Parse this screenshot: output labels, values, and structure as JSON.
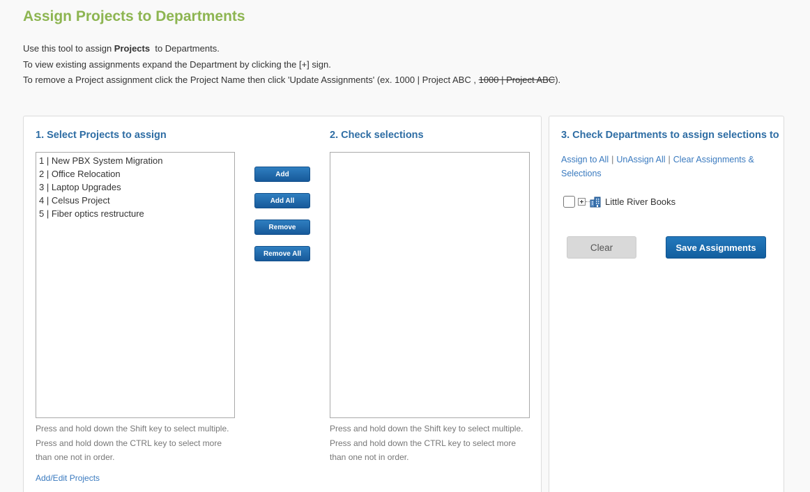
{
  "page": {
    "title": "Assign Projects to Departments",
    "intro": {
      "line1_prefix": "Use this tool to assign ",
      "line1_bold": "Projects",
      "line1_suffix": "  to Departments.",
      "line2": "To view existing assignments expand the Department by clicking the [+] sign.",
      "line3_prefix": "To remove a Project assignment click the Project Name then click 'Update Assignments' (ex. 1000 | Project ABC ,",
      "line3_strike": "1000 | Project ABC",
      "line3_suffix": ")."
    }
  },
  "step1": {
    "title": "1. Select Projects to assign",
    "options": [
      "1 | New PBX System Migration",
      "2 | Office Relocation",
      "3 | Laptop Upgrades",
      "4 | Celsus Project",
      "5 | Fiber optics restructure"
    ],
    "hint_lines": [
      "Press and hold down the Shift key to select multiple.",
      "Press and hold down the CTRL key to select more",
      "than one not in order."
    ],
    "add_edit_link": "Add/Edit Projects"
  },
  "middle_buttons": {
    "add": "Add",
    "add_all": "Add All",
    "remove": "Remove",
    "remove_all": "Remove All"
  },
  "step2": {
    "title": "2. Check selections",
    "hint_lines": [
      "Press and hold down the Shift key to select multiple.",
      "Press and hold down the CTRL key to select more",
      "than one not in order."
    ]
  },
  "step3": {
    "title": "3. Check Departments to assign selections to",
    "links": {
      "assign_all": "Assign to All",
      "unassign_all": "UnAssign All",
      "clear_assignments": "Clear Assignments & Selections",
      "separator": "|"
    },
    "tree": {
      "root_label": "Little River Books",
      "icon": "building-icon"
    },
    "clear_button": "Clear",
    "save_button": "Save Assignments"
  },
  "colors": {
    "title_green": "#8db551",
    "section_blue": "#2e6da4",
    "link_blue": "#3a7abf",
    "button_blue": "#17599a"
  }
}
